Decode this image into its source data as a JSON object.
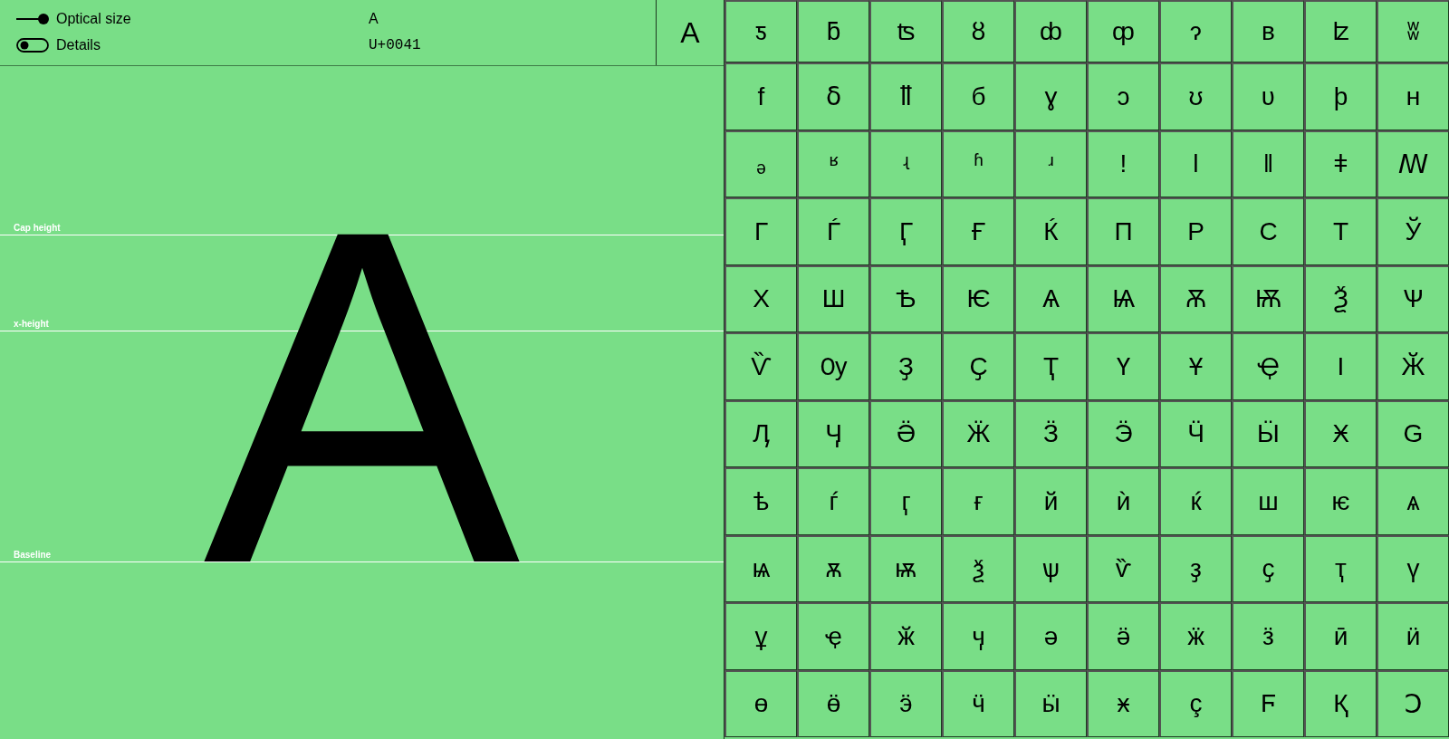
{
  "controls": [
    {
      "kind": "slider",
      "label": "Optical size"
    },
    {
      "kind": "toggle",
      "label": "Details",
      "on": false
    }
  ],
  "glyph_info": {
    "character": "A",
    "codepoint": "U+0041"
  },
  "selected_glyph": "A",
  "preview": {
    "glyph": "A",
    "guides": [
      {
        "kind": "cap",
        "label": "Cap height"
      },
      {
        "kind": "x",
        "label": "x-height"
      },
      {
        "kind": "baseline",
        "label": "Baseline"
      }
    ]
  },
  "glyph_grid": [
    [
      "ƽ",
      "ƃ",
      "ʦ",
      "ȣ",
      "ȸ",
      "ȹ",
      "ɂ",
      "ʙ",
      "ʫ",
      "ʬ"
    ],
    [
      "f",
      "ẟ",
      "ỻ",
      "б",
      "ɣ",
      "ɔ",
      "ʊ",
      "ʋ",
      "þ",
      "ʜ"
    ],
    [
      "ₔ",
      "ʶ",
      "ʵ",
      "ʱ",
      "ʴ",
      "ǃ",
      "ǀ",
      "ǁ",
      "ǂ",
      "ꟿ"
    ],
    [
      "Г",
      "Ѓ",
      "Ӷ",
      "Ғ",
      "Ќ",
      "П",
      "Р",
      "С",
      "Т",
      "Ў"
    ],
    [
      "Х",
      "Ш",
      "Ѣ",
      "Ѥ",
      "Ѧ",
      "Ѩ",
      "Ѫ",
      "Ѭ",
      "Ѯ",
      "Ѱ"
    ],
    [
      "Ѷ",
      "Ѹ",
      "Ҙ",
      "Ҫ",
      "Ҭ",
      "Ү",
      "Ұ",
      "Ҿ",
      "Ӏ",
      "Ӂ"
    ],
    [
      "Ӆ",
      "Ӌ",
      "Ӛ",
      "Ӝ",
      "Ӟ",
      "Ӭ",
      "Ӵ",
      "Ӹ",
      "Ӿ",
      "Ԍ"
    ],
    [
      "ѣ",
      "ѓ",
      "ӷ",
      "ғ",
      "й",
      "ѝ",
      "ќ",
      "ш",
      "ѥ",
      "ѧ"
    ],
    [
      "ѩ",
      "ѫ",
      "ѭ",
      "ѯ",
      "ѱ",
      "ѷ",
      "ҙ",
      "ҫ",
      "ҭ",
      "ү"
    ],
    [
      "ұ",
      "ҿ",
      "ӂ",
      "ӌ",
      "ә",
      "ӛ",
      "ӝ",
      "ӟ",
      "ӣ",
      "ӥ"
    ],
    [
      "ө",
      "ӫ",
      "ӭ",
      "ӵ",
      "ӹ",
      "ӿ",
      "ç",
      "Ϝ",
      "Қ",
      "Ↄ"
    ]
  ]
}
